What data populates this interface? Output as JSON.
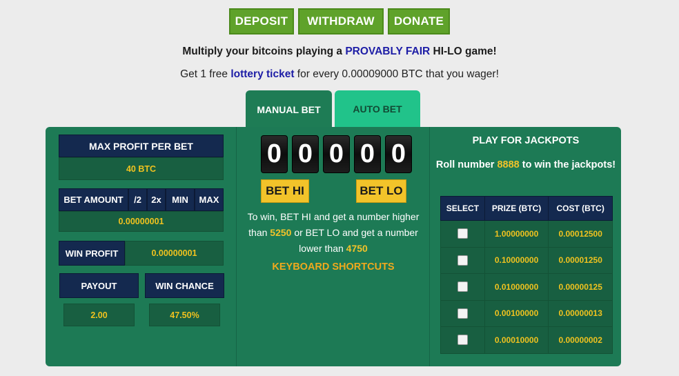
{
  "top_buttons": {
    "deposit": "DEPOSIT",
    "withdraw": "WITHDRAW",
    "donate": "DONATE"
  },
  "tagline": {
    "before": "Multiply your bitcoins playing a ",
    "highlight": "PROVABLY FAIR",
    "after": " HI-LO game!"
  },
  "subline": {
    "before": "Get 1 free ",
    "link": "lottery ticket",
    "after": " for every 0.00009000 BTC that you wager!"
  },
  "tabs": {
    "manual": "MANUAL BET",
    "auto": "AUTO BET"
  },
  "left": {
    "max_profit_label": "MAX PROFIT PER BET",
    "max_profit_value": "40 BTC",
    "bet_amount_label": "BET AMOUNT",
    "half": "/2",
    "double": "2x",
    "min": "MIN",
    "max": "MAX",
    "bet_amount_value": "0.00000001",
    "win_profit_label": "WIN PROFIT",
    "win_profit_value": "0.00000001",
    "payout_label": "PAYOUT",
    "payout_value": "2.00",
    "win_chance_label": "WIN CHANCE",
    "win_chance_value": "47.50%"
  },
  "center": {
    "digits": [
      "0",
      "0",
      "0",
      "0",
      "0"
    ],
    "bet_hi": "BET HI",
    "bet_lo": "BET LO",
    "text1": "To win, BET HI and get a number higher than ",
    "hi_number": "5250",
    "text2": " or BET LO and get a number lower than ",
    "lo_number": "4750",
    "shortcuts": "KEYBOARD SHORTCUTS"
  },
  "jackpots": {
    "title": "PLAY FOR JACKPOTS",
    "desc_before": "Roll number ",
    "desc_number": "8888",
    "desc_after": " to win the jackpots!",
    "columns": [
      "SELECT",
      "PRIZE (BTC)",
      "COST (BTC)"
    ],
    "rows": [
      {
        "prize": "1.00000000",
        "cost": "0.00012500"
      },
      {
        "prize": "0.10000000",
        "cost": "0.00001250"
      },
      {
        "prize": "0.01000000",
        "cost": "0.00000125"
      },
      {
        "prize": "0.00100000",
        "cost": "0.00000013"
      },
      {
        "prize": "0.00010000",
        "cost": "0.00000002"
      }
    ]
  }
}
